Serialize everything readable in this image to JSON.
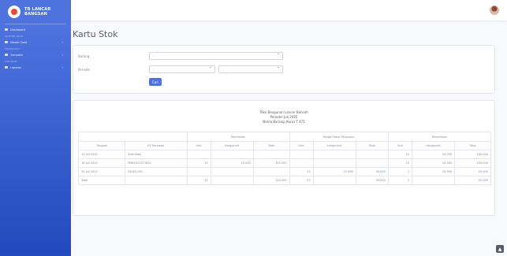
{
  "brand": {
    "line1": "TB LANCAR",
    "line2": "BANGSAN"
  },
  "sidebar": {
    "items": [
      {
        "label": "Dashboard",
        "heading_after": "MASTER DATA"
      },
      {
        "label": "Master Data",
        "chev": "›",
        "heading_after": "TRANSAKSI"
      },
      {
        "label": "Transaksi",
        "chev": "›",
        "heading_after": "LAPORAN"
      },
      {
        "label": "Laporan",
        "chev": "›"
      }
    ]
  },
  "page": {
    "title": "Kartu Stok"
  },
  "filter": {
    "barang_label": "Barang",
    "barang_value": "-",
    "periode_label": "Periode",
    "month_value": "-",
    "year_value": "-",
    "search_button": "Cari"
  },
  "report": {
    "line1": "Toko Bangunan Lancar Bansah",
    "line2": "Periode: Juli 2022",
    "line3": "Nama Barang: Kunci T 475",
    "groups": {
      "pembelian": "Pembelian",
      "penjualan": "Harga Pokok Penjualan",
      "persediaan": "Persediaan"
    },
    "headers": [
      "Tanggal",
      "ID Transaksi",
      "Unit",
      "Harga/unit",
      "Total",
      "Unit",
      "Harga/unit",
      "Total",
      "Unit",
      "Harga/unit",
      "Total"
    ],
    "rows": [
      [
        "13 Juli 2022",
        "Stok Awal",
        "",
        "",
        "",
        "",
        "",
        "",
        "10",
        "10.000",
        "100.000"
      ],
      [
        "18 Juli 2022",
        "PMB2022071801",
        "15",
        "10.000",
        "150.000",
        "",
        "",
        "",
        "25",
        "10.000",
        "250.000"
      ],
      [
        "30 Juli 2022",
        "SALES-001",
        "",
        "",
        "",
        "23",
        "10.000",
        "30.000",
        "2",
        "10.000",
        "20.000"
      ],
      [
        "Total",
        "",
        "15",
        "",
        "150.000",
        "23",
        "",
        "30.000",
        "2",
        "",
        "20.000"
      ]
    ]
  },
  "scroll_top_icon": "chevron-up-icon",
  "colors": {
    "sidebar": "#4e73df",
    "accent": "#e74a3b",
    "page_bg": "#f8f9fc"
  }
}
